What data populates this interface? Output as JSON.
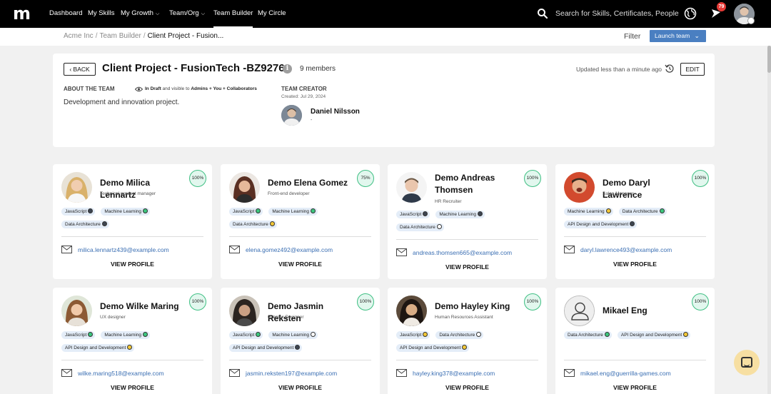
{
  "nav": {
    "logo": "m",
    "items": [
      {
        "label": "Dashboard",
        "name": "nav-dashboard"
      },
      {
        "label": "My Skills",
        "name": "nav-my-skills"
      },
      {
        "label": "My Growth",
        "name": "nav-my-growth"
      },
      {
        "label": "Team/Org",
        "name": "nav-team-org"
      },
      {
        "label": "Team Builder",
        "name": "nav-team-builder"
      },
      {
        "label": "My Circle",
        "name": "nav-my-circle"
      }
    ],
    "search_placeholder": "Search for Skills, Certificates, People",
    "notification_count": "79"
  },
  "breadcrumb": {
    "items": [
      "Acme Inc",
      "Team Builder"
    ],
    "current": "Client Project - Fusion..."
  },
  "toolbar": {
    "filter_label": "Filter",
    "launch_label": "Launch team"
  },
  "team": {
    "back_label": "BACK",
    "title": "Client Project - FusionTech -BZ9276",
    "members": "9 members",
    "updated": "Updated less than a minute ago",
    "edit_label": "EDIT",
    "about_label": "ABOUT THE TEAM",
    "visibility_status": "In Draft",
    "visibility_mid": " and visible to ",
    "visibility_audience": "Admins + You + Collaborators",
    "about_text": "Development and innovation project.",
    "creator_label": "TEAM CREATOR",
    "created": "Created: Jul 29, 2024",
    "creator_name": "Daniel Nilsson",
    "creator_sub": "-"
  },
  "colors": {
    "dot_green": "#3cc77e",
    "dot_dark": "#3d4551",
    "dot_yellow": "#f3c836",
    "link": "#3b6fb3",
    "accent": "#4a7fc1"
  },
  "view_profile_label": "VIEW PROFILE",
  "cards": [
    {
      "name": "Demo Milica Lennartz",
      "role": "Technical product manager",
      "pct": "100%",
      "email": "milica.lennartz439@example.com",
      "tags": [
        {
          "label": "JavaScript",
          "dot": "dark"
        },
        {
          "label": "Machine Learning",
          "dot": "green"
        },
        {
          "label": "Data Architecture",
          "dot": "dark"
        }
      ]
    },
    {
      "name": "Demo Elena Gomez",
      "role": "Front-end developer",
      "pct": "75%",
      "email": "elena.gomez492@example.com",
      "tags": [
        {
          "label": "JavaScript",
          "dot": "green"
        },
        {
          "label": "Machine Learning",
          "dot": "green"
        },
        {
          "label": "Data Architecture",
          "dot": "yellow"
        }
      ]
    },
    {
      "name": "Demo Andreas Thomsen",
      "role": "HR Recruiter",
      "pct": "100%",
      "email": "andreas.thomsen665@example.com",
      "tags": [
        {
          "label": "JavaScript",
          "dot": "dark"
        },
        {
          "label": "Machine Learning",
          "dot": "dark"
        },
        {
          "label": "Data Architecture",
          "dot": "empty"
        }
      ]
    },
    {
      "name": "Demo Daryl Lawrence",
      "role": "Sales Manager",
      "pct": "100%",
      "email": "daryl.lawrence493@example.com",
      "tags": [
        {
          "label": "Machine Learning",
          "dot": "yellow"
        },
        {
          "label": "Data Architecture",
          "dot": "green"
        },
        {
          "label": "API Design and Development",
          "dot": "dark"
        }
      ]
    },
    {
      "name": "Demo Wilke Maring",
      "role": "UX designer",
      "pct": "100%",
      "email": "wilke.maring518@example.com",
      "tags": [
        {
          "label": "JavaScript",
          "dot": "green"
        },
        {
          "label": "Machine Learning",
          "dot": "green"
        },
        {
          "label": "API Design and Development",
          "dot": "yellow"
        }
      ]
    },
    {
      "name": "Demo Jasmin Reksten",
      "role": "Graphic Designer",
      "pct": "100%",
      "email": "jasmin.reksten197@example.com",
      "tags": [
        {
          "label": "JavaScript",
          "dot": "green"
        },
        {
          "label": "Machine Learning",
          "dot": "empty"
        },
        {
          "label": "API Design and Development",
          "dot": "dark"
        }
      ]
    },
    {
      "name": "Demo Hayley King",
      "role": "Human Resources Assistant",
      "pct": "100%",
      "email": "hayley.king378@example.com",
      "tags": [
        {
          "label": "JavaScript",
          "dot": "yellow"
        },
        {
          "label": "Data Architecture",
          "dot": "empty"
        },
        {
          "label": "API Design and Development",
          "dot": "yellow"
        }
      ]
    },
    {
      "name": "Mikael Eng",
      "role": "",
      "pct": "100%",
      "email": "mikael.eng@guerrilla-games.com",
      "tags": [
        {
          "label": "Data Architecture",
          "dot": "green"
        },
        {
          "label": "API Design and Development",
          "dot": "yellow"
        }
      ]
    }
  ]
}
